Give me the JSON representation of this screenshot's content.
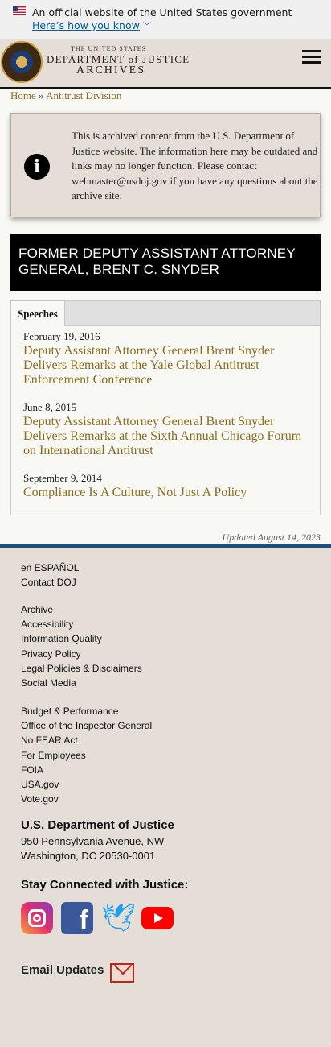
{
  "gov_banner": {
    "text": "An official website of the United States government",
    "link": "Here’s how you know"
  },
  "header": {
    "logo_line1": "THE UNITED STATES",
    "logo_line2": "DEPARTMENT of JUSTICE",
    "logo_line3": "ARCHIVES"
  },
  "breadcrumb": {
    "home": "Home",
    "separator": "»",
    "current": "Antitrust Division"
  },
  "archive_notice": {
    "text": "This is archived content from the U.S. Department of Justice website. The information here may be outdated and links may no longer function. Please contact webmaster@usdoj.gov if you have any questions about the archive site."
  },
  "page_title": "FORMER DEPUTY ASSISTANT ATTORNEY GENERAL, BRENT C. SNYDER",
  "tabs": [
    {
      "label": "Speeches"
    }
  ],
  "speeches": [
    {
      "date": "February 19, 2016",
      "title": "Deputy Assistant Attorney General Brent Snyder Delivers Remarks at the Yale Global Antitrust Enforcement Conference"
    },
    {
      "date": "June 8, 2015",
      "title": "Deputy Assistant Attorney General Brent Snyder Delivers Remarks at the Sixth Annual Chicago Forum on International Antitrust"
    },
    {
      "date": "September 9, 2014",
      "title": "Compliance Is A Culture, Not Just A Policy"
    }
  ],
  "updated": "Updated August 14, 2023",
  "footer": {
    "group1": [
      "en ESPAÑOL",
      "Contact DOJ"
    ],
    "group2": [
      "Archive",
      "Accessibility",
      "Information Quality",
      "Privacy Policy",
      "Legal Policies & Disclaimers",
      "Social Media"
    ],
    "group3": [
      "Budget & Performance",
      "Office of the Inspector General",
      "No FEAR Act",
      "For Employees",
      "FOIA",
      "USA.gov",
      "Vote.gov"
    ],
    "address_title": "U.S. Department of Justice",
    "address_line1": "950 Pennsylvania Avenue, NW",
    "address_line2": "Washington, DC 20530-0001",
    "stay_connected": "Stay Connected with Justice:",
    "email_updates": "Email Updates"
  },
  "colors": {
    "link_gold": "#8a6d1f",
    "header_bg": "#e5ded6",
    "footer_rule": "#1a4f82",
    "title_bar": "#000000"
  }
}
